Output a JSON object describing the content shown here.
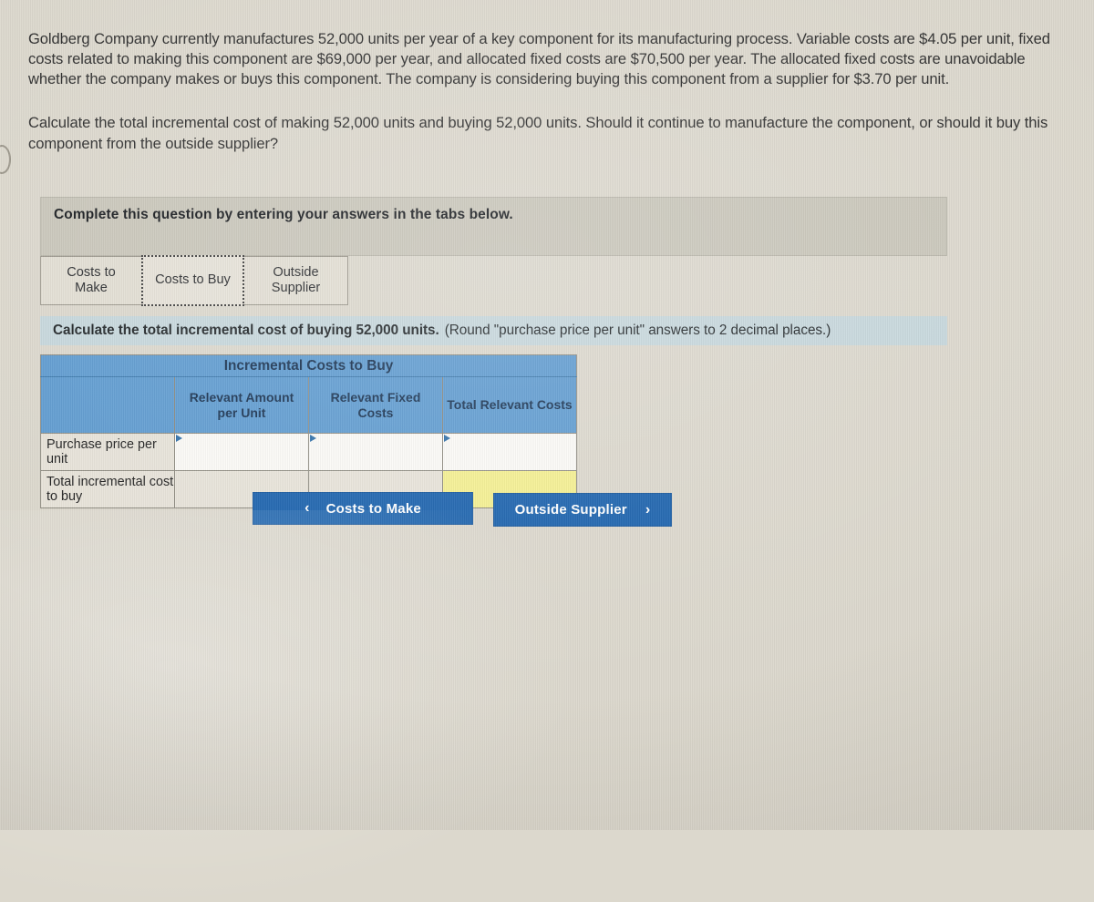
{
  "question": {
    "paragraph1": "Goldberg Company currently manufactures 52,000 units per year of a key component for its manufacturing process. Variable costs are $4.05 per unit, fixed costs related to making this component are $69,000 per year, and allocated fixed costs are $70,500 per year. The allocated fixed costs are unavoidable whether the company makes or buys this component. The company is considering buying this component from a supplier for $3.70 per unit.",
    "paragraph2": "Calculate the total incremental cost of making 52,000 units and buying 52,000 units. Should it continue to manufacture the component, or should it buy this component from the outside supplier?"
  },
  "complete_banner": {
    "text": "Complete this question by entering your answers in the tabs below."
  },
  "tabs": [
    {
      "label": "Costs to Make",
      "selected": false
    },
    {
      "label": "Costs to Buy",
      "selected": true
    },
    {
      "label": "Outside Supplier",
      "selected": false
    }
  ],
  "calc_instruction": {
    "bold": "Calculate the total incremental cost of buying 52,000 units.",
    "normal": "(Round \"purchase price per unit\" answers to 2 decimal places.)"
  },
  "table": {
    "main_header": "Incremental Costs to Buy",
    "column_headers": [
      "",
      "Relevant Amount per Unit",
      "Relevant Fixed Costs",
      "Total Relevant Costs"
    ],
    "rows": [
      {
        "label": "Purchase price per unit",
        "cells": [
          {
            "type": "input",
            "value": ""
          },
          {
            "type": "input",
            "value": ""
          },
          {
            "type": "input",
            "value": ""
          }
        ]
      },
      {
        "label": "Total incremental cost to buy",
        "cells": [
          {
            "type": "filler",
            "value": ""
          },
          {
            "type": "filler",
            "value": ""
          },
          {
            "type": "total",
            "value": ""
          }
        ]
      }
    ]
  },
  "nav": {
    "prev_label": "Costs to Make",
    "prev_chevron": "‹",
    "next_label": "Outside Supplier",
    "next_chevron": "›"
  },
  "colors": {
    "page_background": "#dcd8cd",
    "banner_gray": "#c9c6ba",
    "instruction_blue": "#c6d7dc",
    "table_header_blue": "#5e9bd0",
    "table_header_text": "#16304f",
    "row_label_beige": "#e7e3d9",
    "total_cell_yellow": "#f4ef90",
    "button_blue": "#1a62ad",
    "input_cell_white": "#fbfaf6"
  }
}
